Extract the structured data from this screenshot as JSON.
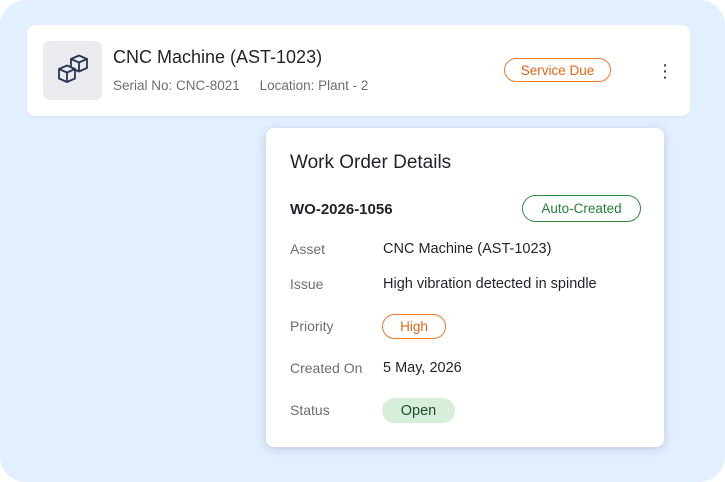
{
  "asset": {
    "icon": "boxes-icon",
    "title": "CNC Machine (AST-1023)",
    "serial": "Serial No: CNC-8021",
    "location": "Location: Plant - 2",
    "badge": "Service Due",
    "menu_icon": "kebab-menu-icon",
    "menu_glyph": "⋮"
  },
  "work_order": {
    "title": "Work Order Details",
    "id": "WO-2026-1056",
    "id_badge": "Auto-Created",
    "rows": [
      {
        "label": "Asset",
        "value": "CNC Machine (AST-1023)"
      },
      {
        "label": "Issue",
        "value": "High vibration detected in spindle"
      },
      {
        "label": "Priority",
        "value": "High"
      },
      {
        "label": "Created On",
        "value": "5 May, 2026"
      },
      {
        "label": "Status",
        "value": "Open"
      }
    ]
  },
  "colors": {
    "background": "#e2efff",
    "warning_orange": "#f07a2c",
    "success_green": "#2e8b3e",
    "status_open_bg": "#d7efda"
  }
}
